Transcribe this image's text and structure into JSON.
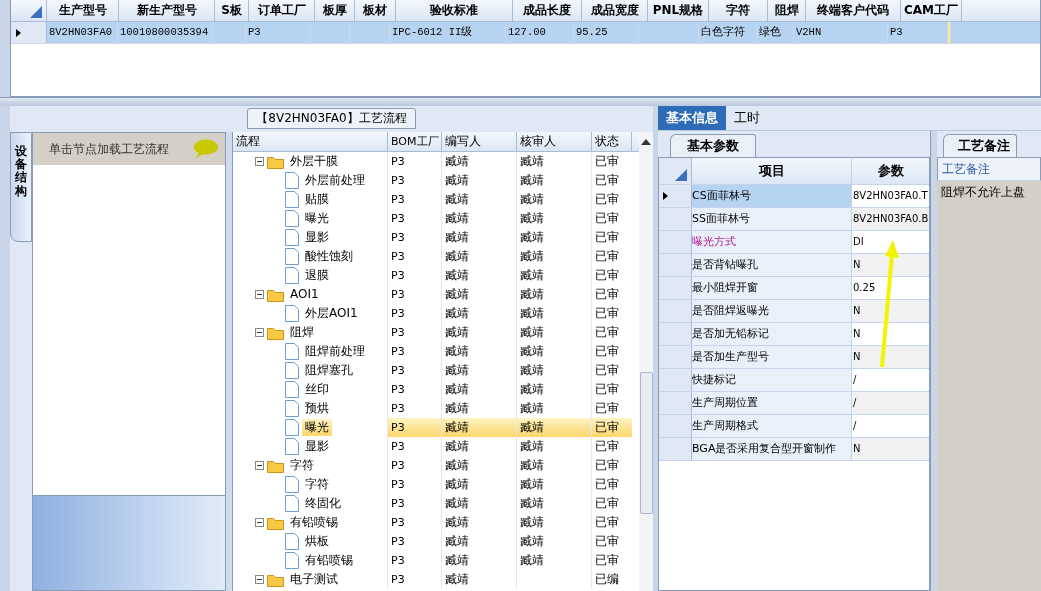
{
  "order_grid": {
    "columns": [
      "生产型号",
      "新生产型号",
      "S板",
      "订单工厂",
      "板厚",
      "板材",
      "验收标准",
      "成品长度",
      "成品宽度",
      "PNL规格",
      "字符",
      "阻焊",
      "终端客户代码",
      "CAM工厂"
    ],
    "rows": [
      {
        "selected": true,
        "cells": [
          "8V2HN03FA0",
          "10010800035394",
          null,
          "P3",
          null,
          null,
          "IPC-6012 II级",
          "127.00",
          "95.25",
          null,
          "白色字符",
          "绿色",
          "V2HN",
          "P3"
        ]
      }
    ]
  },
  "flow_panel": {
    "title": "【8V2HN03FA0】工艺流程",
    "side_tab": "设备结构",
    "hint": "单击节点加载工艺流程",
    "columns": [
      "流程",
      "BOM工厂",
      "编写人",
      "核审人",
      "状态"
    ],
    "tree": [
      {
        "label": "外层干膜",
        "kind": "folder",
        "expanded": true,
        "selected": false,
        "bom": "P3",
        "writer": "臧靖",
        "reviewer": "臧靖",
        "status": "已审",
        "children": [
          {
            "label": "外层前处理",
            "kind": "step",
            "selected": false,
            "bom": "P3",
            "writer": "臧靖",
            "reviewer": "臧靖",
            "status": "已审"
          },
          {
            "label": "贴膜",
            "kind": "step",
            "selected": false,
            "bom": "P3",
            "writer": "臧靖",
            "reviewer": "臧靖",
            "status": "已审"
          },
          {
            "label": "曝光",
            "kind": "step",
            "selected": false,
            "bom": "P3",
            "writer": "臧靖",
            "reviewer": "臧靖",
            "status": "已审"
          },
          {
            "label": "显影",
            "kind": "step",
            "selected": false,
            "bom": "P3",
            "writer": "臧靖",
            "reviewer": "臧靖",
            "status": "已审"
          },
          {
            "label": "酸性蚀刻",
            "kind": "step",
            "selected": false,
            "bom": "P3",
            "writer": "臧靖",
            "reviewer": "臧靖",
            "status": "已审"
          },
          {
            "label": "退膜",
            "kind": "step",
            "selected": false,
            "bom": "P3",
            "writer": "臧靖",
            "reviewer": "臧靖",
            "status": "已审"
          }
        ]
      },
      {
        "label": "AOI1",
        "kind": "folder",
        "expanded": true,
        "selected": false,
        "bom": "P3",
        "writer": "臧靖",
        "reviewer": "臧靖",
        "status": "已审",
        "children": [
          {
            "label": "外层AOI1",
            "kind": "step",
            "selected": false,
            "bom": "P3",
            "writer": "臧靖",
            "reviewer": "臧靖",
            "status": "已审"
          }
        ]
      },
      {
        "label": "阻焊",
        "kind": "folder",
        "expanded": true,
        "selected": false,
        "bom": "P3",
        "writer": "臧靖",
        "reviewer": "臧靖",
        "status": "已审",
        "children": [
          {
            "label": "阻焊前处理",
            "kind": "step",
            "selected": false,
            "bom": "P3",
            "writer": "臧靖",
            "reviewer": "臧靖",
            "status": "已审"
          },
          {
            "label": "阻焊塞孔",
            "kind": "step",
            "selected": false,
            "bom": "P3",
            "writer": "臧靖",
            "reviewer": "臧靖",
            "status": "已审"
          },
          {
            "label": "丝印",
            "kind": "step",
            "selected": false,
            "bom": "P3",
            "writer": "臧靖",
            "reviewer": "臧靖",
            "status": "已审"
          },
          {
            "label": "预烘",
            "kind": "step",
            "selected": false,
            "bom": "P3",
            "writer": "臧靖",
            "reviewer": "臧靖",
            "status": "已审"
          },
          {
            "label": "曝光",
            "kind": "step",
            "selected": true,
            "bom": "P3",
            "writer": "臧靖",
            "reviewer": "臧靖",
            "status": "已审"
          },
          {
            "label": "显影",
            "kind": "step",
            "selected": false,
            "bom": "P3",
            "writer": "臧靖",
            "reviewer": "臧靖",
            "status": "已审"
          }
        ]
      },
      {
        "label": "字符",
        "kind": "folder",
        "expanded": true,
        "selected": false,
        "bom": "P3",
        "writer": "臧靖",
        "reviewer": "臧靖",
        "status": "已审",
        "children": [
          {
            "label": "字符",
            "kind": "step",
            "selected": false,
            "bom": "P3",
            "writer": "臧靖",
            "reviewer": "臧靖",
            "status": "已审"
          },
          {
            "label": "终固化",
            "kind": "step",
            "selected": false,
            "bom": "P3",
            "writer": "臧靖",
            "reviewer": "臧靖",
            "status": "已审"
          }
        ]
      },
      {
        "label": "有铅喷锡",
        "kind": "folder",
        "expanded": true,
        "selected": false,
        "bom": "P3",
        "writer": "臧靖",
        "reviewer": "臧靖",
        "status": "已审",
        "children": [
          {
            "label": "烘板",
            "kind": "step",
            "selected": false,
            "bom": "P3",
            "writer": "臧靖",
            "reviewer": "臧靖",
            "status": "已审"
          },
          {
            "label": "有铅喷锡",
            "kind": "step",
            "selected": false,
            "bom": "P3",
            "writer": "臧靖",
            "reviewer": "臧靖",
            "status": "已审"
          }
        ]
      },
      {
        "label": "电子测试",
        "kind": "folder",
        "expanded": true,
        "selected": false,
        "bom": "P3",
        "writer": "臧靖",
        "status": "已编"
      }
    ]
  },
  "info_panel": {
    "tabs": [
      {
        "label": "基本信息",
        "selected": true
      },
      {
        "label": "工时",
        "selected": false
      }
    ],
    "params_tab": "基本参数",
    "columns": [
      "项目",
      "参数"
    ],
    "params": [
      {
        "item": "CS面菲林号",
        "value": "8V2HN03FA0.T",
        "selected": true,
        "highlighted": false
      },
      {
        "item": "SS面菲林号",
        "value": "8V2HN03FA0.B",
        "selected": false,
        "highlighted": false
      },
      {
        "item": "曝光方式",
        "value": "DI",
        "selected": false,
        "highlighted": true
      },
      {
        "item": "是否背钻曝孔",
        "value": "N",
        "selected": false,
        "highlighted": false
      },
      {
        "item": "最小阻焊开窗",
        "value": "0.25",
        "selected": false,
        "highlighted": false
      },
      {
        "item": "是否阻焊返曝光",
        "value": "N",
        "selected": false,
        "highlighted": false
      },
      {
        "item": "是否加无铅标记",
        "value": "N",
        "selected": false,
        "highlighted": false
      },
      {
        "item": "是否加生产型号",
        "value": "N",
        "selected": false,
        "highlighted": false
      },
      {
        "item": "快捷标记",
        "value": "/",
        "selected": false,
        "highlighted": false
      },
      {
        "item": "生产周期位置",
        "value": "/",
        "selected": false,
        "highlighted": false
      },
      {
        "item": "生产周期格式",
        "value": "/",
        "selected": false,
        "highlighted": false
      },
      {
        "item": "BGA是否采用复合型开窗制作",
        "value": "N",
        "selected": false,
        "highlighted": false
      }
    ],
    "notes_tab": "工艺备注",
    "notes_header": "工艺备注",
    "notes_text": "阻焊不允许上盘"
  }
}
